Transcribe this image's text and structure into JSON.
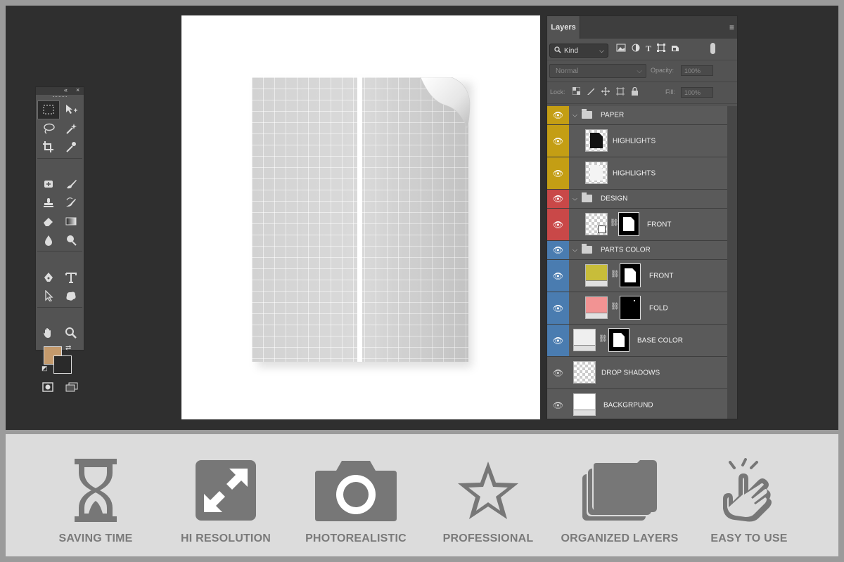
{
  "tools_panel": {
    "collapse_glyph": "«",
    "close_glyph": "×",
    "colors": {
      "foreground": "#c49a6c",
      "background": "#2a2a2a"
    }
  },
  "layers_panel": {
    "tab_label": "Layers",
    "menu_glyph": "≡",
    "kind_filter": "Kind",
    "blend_mode": "Normal",
    "opacity_label": "Opacity:",
    "opacity_value": "100%",
    "lock_label": "Lock:",
    "fill_label": "Fill:",
    "fill_value": "100%",
    "layers": [
      {
        "name": "PAPER",
        "type": "group",
        "color": "yellow"
      },
      {
        "name": "HIGHLIGHTS",
        "type": "layer",
        "color": "yellow",
        "thumb": "dark"
      },
      {
        "name": "HIGHLIGHTS",
        "type": "layer",
        "color": "yellow",
        "thumb": "light"
      },
      {
        "name": "DESIGN",
        "type": "group",
        "color": "red"
      },
      {
        "name": "FRONT",
        "type": "smart",
        "color": "red"
      },
      {
        "name": "PARTS COLOR",
        "type": "group",
        "color": "blue"
      },
      {
        "name": "FRONT",
        "type": "fill",
        "color": "blue",
        "swatch": "#c8bd3a"
      },
      {
        "name": "FOLD",
        "type": "fill",
        "color": "blue",
        "swatch": "#f29393"
      },
      {
        "name": "BASE COLOR",
        "type": "fill",
        "color": "blue",
        "swatch": "#efefef"
      },
      {
        "name": "DROP SHADOWS",
        "type": "layer",
        "color": "none",
        "thumb": "checker"
      },
      {
        "name": "BACKGRPUND",
        "type": "fill-plain",
        "color": "none",
        "swatch": "#ffffff"
      }
    ]
  },
  "features": [
    {
      "label": "SAVING TIME",
      "icon": "hourglass-icon"
    },
    {
      "label": "HI RESOLUTION",
      "icon": "expand-icon"
    },
    {
      "label": "PHOTOREALISTIC",
      "icon": "camera-icon"
    },
    {
      "label": "PROFESSIONAL",
      "icon": "star-icon"
    },
    {
      "label": "ORGANIZED LAYERS",
      "icon": "layers-icon"
    },
    {
      "label": "EASY TO USE",
      "icon": "hand-icon"
    }
  ]
}
